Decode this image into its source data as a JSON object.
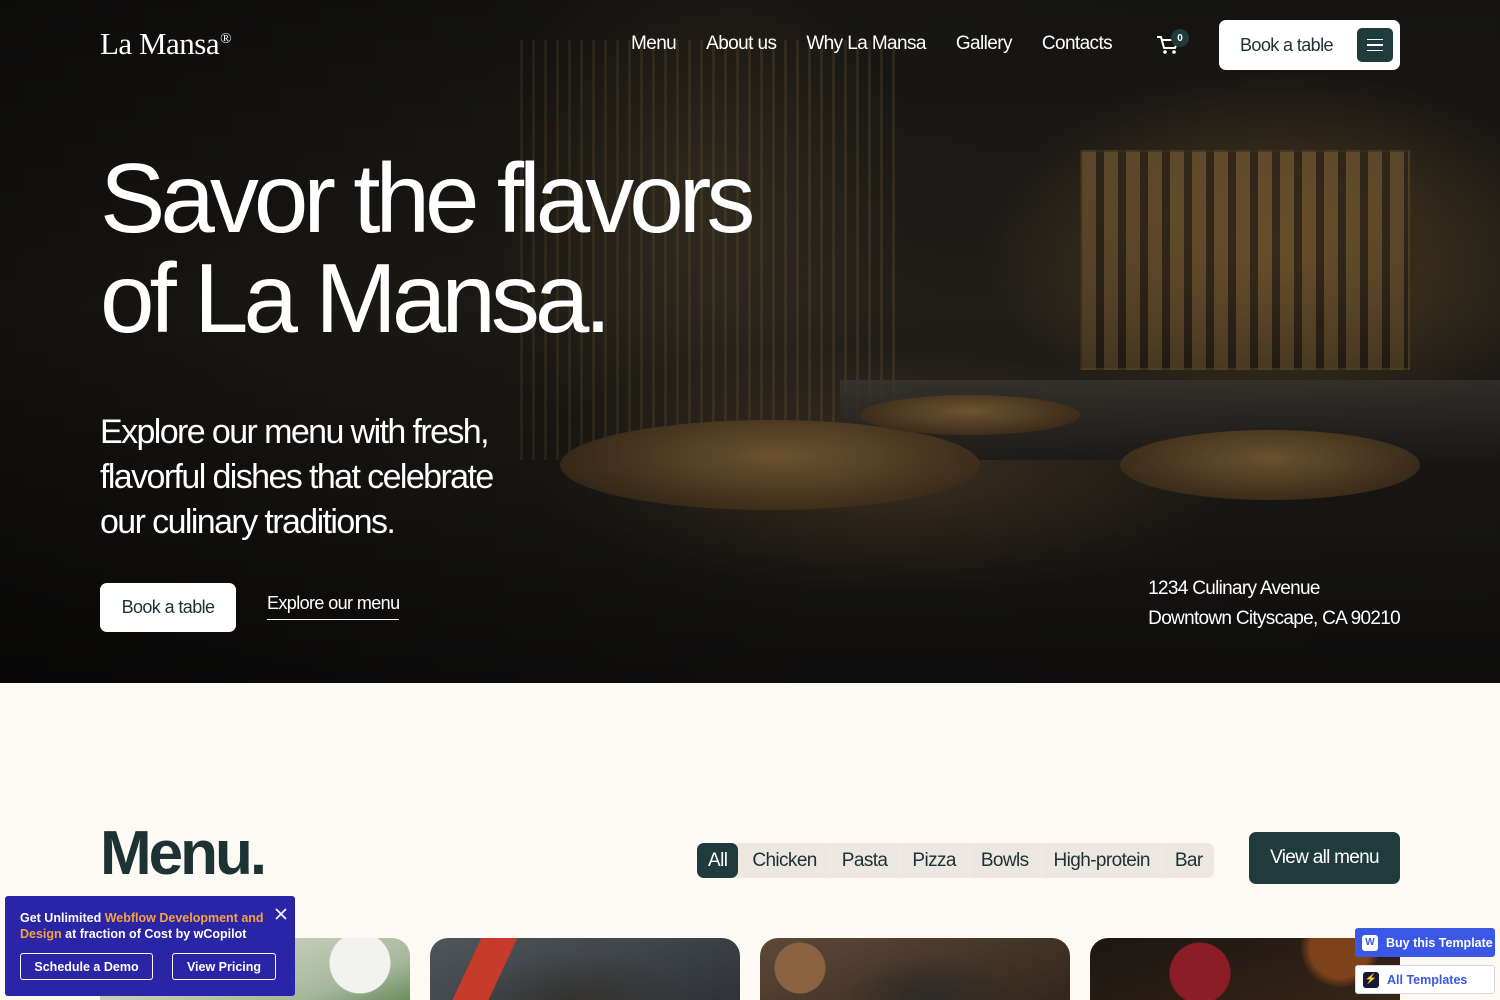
{
  "brand": {
    "name": "La Mansa",
    "mark": "®"
  },
  "nav": {
    "items": [
      {
        "label": "Menu"
      },
      {
        "label": "About us"
      },
      {
        "label": "Why La Mansa"
      },
      {
        "label": "Gallery"
      },
      {
        "label": "Contacts"
      }
    ],
    "cart_count": "0",
    "book_label": "Book a table"
  },
  "hero": {
    "title_line1": "Savor the flavors",
    "title_line2": "of La Mansa.",
    "lead": "Explore our menu with fresh, flavorful dishes that celebrate our culinary traditions.",
    "book_label": "Book a table",
    "explore_label": "Explore our menu",
    "address_line1": "1234 Culinary Avenue",
    "address_line2": "Downtown Cityscape, CA 90210"
  },
  "menu_section": {
    "title": "Menu.",
    "filters": [
      "All",
      "Chicken",
      "Pasta",
      "Pizza",
      "Bowls",
      "High-protein",
      "Bar"
    ],
    "active_filter": "All",
    "view_all_label": "View all menu"
  },
  "promo": {
    "text_prefix": "Get Unlimited ",
    "text_highlight": "Webflow Development and Design",
    "text_suffix": " at fraction of Cost by wCopilot",
    "button1": "Schedule a Demo",
    "button2": "View Pricing",
    "highlight_color": "#f4a340",
    "background_color": "#2a24a6"
  },
  "badges": {
    "buy_label": "Buy this Template",
    "all_label": "All Templates"
  },
  "colors": {
    "primary_dark": "#1f3b3c",
    "page_background": "#fdf9f3",
    "badge_blue": "#3b57e6"
  },
  "icons": [
    "cart-icon",
    "hamburger-icon",
    "close-icon",
    "webflow-icon",
    "templates-icon"
  ]
}
